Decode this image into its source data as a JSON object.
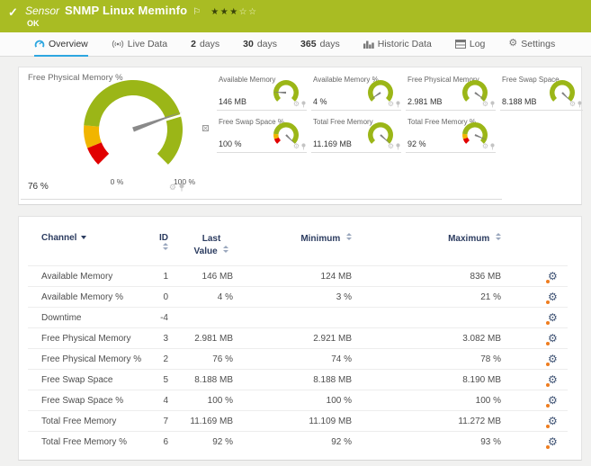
{
  "header": {
    "kind": "Sensor",
    "title": "SNMP Linux Meminfo",
    "status": "OK",
    "stars_filled": 3,
    "stars_total": 5
  },
  "tabs": [
    {
      "id": "overview",
      "label": "Overview",
      "icon": "gauge-icon",
      "active": true
    },
    {
      "id": "live-data",
      "label": "Live Data",
      "icon": "broadcast-icon",
      "active": false
    },
    {
      "id": "2-days",
      "num": "2",
      "label": "days",
      "active": false
    },
    {
      "id": "30-days",
      "num": "30",
      "label": "days",
      "active": false
    },
    {
      "id": "365-days",
      "num": "365",
      "label": "days",
      "active": false
    },
    {
      "id": "historic-data",
      "label": "Historic Data",
      "icon": "chart-icon",
      "active": false
    },
    {
      "id": "log",
      "label": "Log",
      "icon": "log-icon",
      "active": false
    },
    {
      "id": "settings",
      "label": "Settings",
      "icon": "gear-icon",
      "active": false
    }
  ],
  "overview": {
    "main_gauge": {
      "title": "Free Physical Memory %",
      "value_label": "76 %",
      "value_fraction": 0.76,
      "scale_min_label": "0 %",
      "scale_max_label": "100 %",
      "segments": [
        {
          "from": 0,
          "to": 0.085,
          "color": "#e10000"
        },
        {
          "from": 0.085,
          "to": 0.185,
          "color": "#f1b500"
        },
        {
          "from": 0.185,
          "to": 1,
          "color": "#9bb617"
        }
      ]
    },
    "mini_gauges": [
      {
        "title": "Available Memory",
        "value_label": "146 MB",
        "value_fraction": 0.175,
        "segments": "plain"
      },
      {
        "title": "Available Memory %",
        "value_label": "4 %",
        "value_fraction": 0.04,
        "segments": "plain"
      },
      {
        "title": "Free Physical Memory",
        "value_label": "2.981 MB",
        "value_fraction": 0.967,
        "segments": "plain"
      },
      {
        "title": "Free Swap Space",
        "value_label": "8.188 MB",
        "value_fraction": 0.9995,
        "segments": "plain"
      },
      {
        "title": "Free Swap Space %",
        "value_label": "100 %",
        "value_fraction": 1.0,
        "segments": "banded"
      },
      {
        "title": "Total Free Memory",
        "value_label": "11.169 MB",
        "value_fraction": 0.991,
        "segments": "plain"
      },
      {
        "title": "Total Free Memory %",
        "value_label": "92 %",
        "value_fraction": 0.92,
        "segments": "banded"
      }
    ]
  },
  "table": {
    "columns": [
      {
        "key": "channel",
        "label": "Channel",
        "sorted": "desc"
      },
      {
        "key": "id",
        "label": "ID"
      },
      {
        "key": "last_value",
        "label": "Last Value"
      },
      {
        "key": "minimum",
        "label": "Minimum"
      },
      {
        "key": "maximum",
        "label": "Maximum"
      }
    ],
    "rows": [
      {
        "channel": "Available Memory",
        "id": "1",
        "last_value": "146 MB",
        "minimum": "124 MB",
        "maximum": "836 MB"
      },
      {
        "channel": "Available Memory %",
        "id": "0",
        "last_value": "4 %",
        "minimum": "3 %",
        "maximum": "21 %"
      },
      {
        "channel": "Downtime",
        "id": "-4",
        "last_value": "",
        "minimum": "",
        "maximum": ""
      },
      {
        "channel": "Free Physical Memory",
        "id": "3",
        "last_value": "2.981 MB",
        "minimum": "2.921 MB",
        "maximum": "3.082 MB"
      },
      {
        "channel": "Free Physical Memory %",
        "id": "2",
        "last_value": "76 %",
        "minimum": "74 %",
        "maximum": "78 %"
      },
      {
        "channel": "Free Swap Space",
        "id": "5",
        "last_value": "8.188 MB",
        "minimum": "8.188 MB",
        "maximum": "8.190 MB"
      },
      {
        "channel": "Free Swap Space %",
        "id": "4",
        "last_value": "100 %",
        "minimum": "100 %",
        "maximum": "100 %"
      },
      {
        "channel": "Total Free Memory",
        "id": "7",
        "last_value": "11.169 MB",
        "minimum": "11.109 MB",
        "maximum": "11.272 MB"
      },
      {
        "channel": "Total Free Memory %",
        "id": "6",
        "last_value": "92 %",
        "minimum": "92 %",
        "maximum": "93 %"
      }
    ]
  },
  "colors": {
    "status_green": "#a9bc23",
    "gauge_green": "#9bb617",
    "gauge_yellow": "#f1b500",
    "gauge_red": "#e10000",
    "needle_gray": "#8a8a8a",
    "accent_blue": "#2da6e0",
    "table_header_navy": "#2c3c60"
  }
}
